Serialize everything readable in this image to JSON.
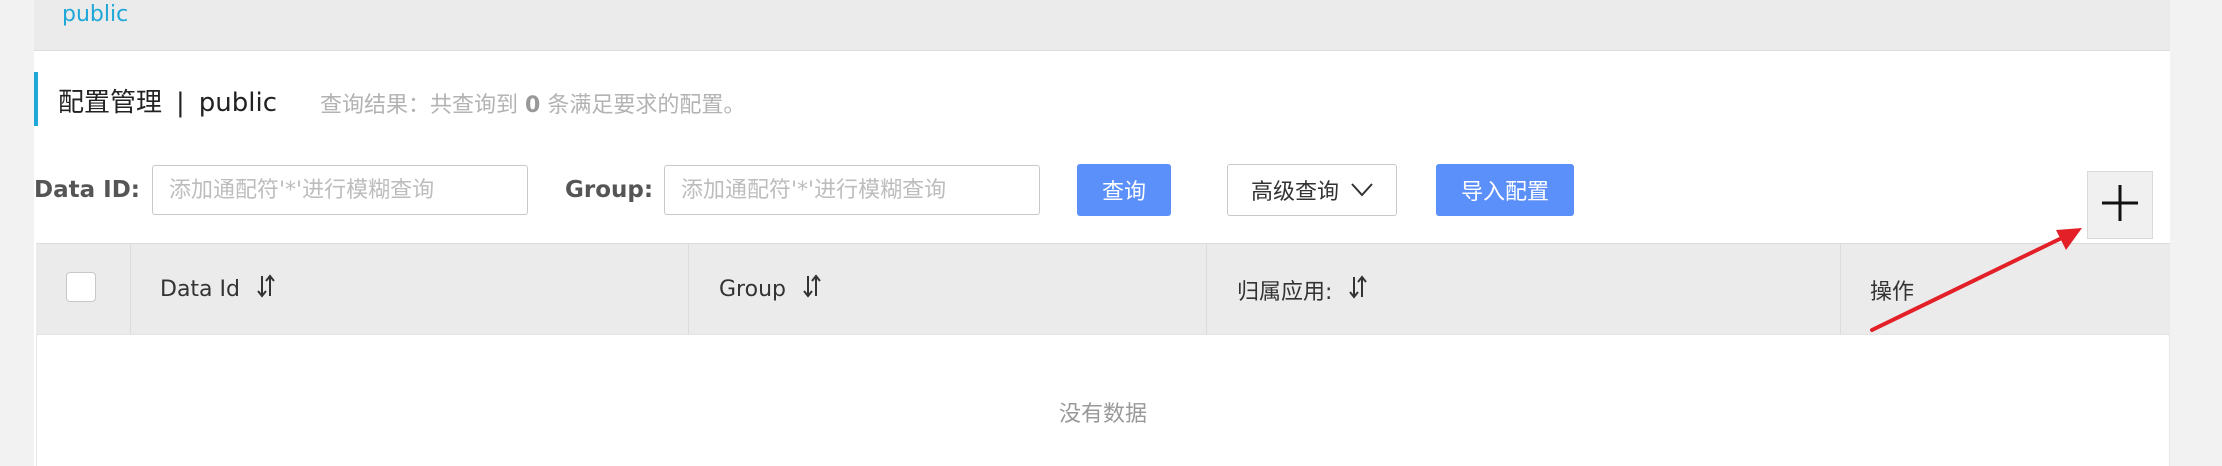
{
  "namespace_bar": {
    "active": "public"
  },
  "header": {
    "title": "配置管理",
    "separator": "|",
    "namespace": "public",
    "result_prefix": "查询结果：共查询到",
    "result_count": "0",
    "result_suffix": "条满足要求的配置。"
  },
  "search": {
    "data_id_label": "Data ID:",
    "data_id_placeholder": "添加通配符'*'进行模糊查询",
    "data_id_value": "",
    "group_label": "Group:",
    "group_placeholder": "添加通配符'*'进行模糊查询",
    "group_value": "",
    "query_button": "查询",
    "advanced_button": "高级查询",
    "import_button": "导入配置"
  },
  "table": {
    "columns": [
      {
        "label": "Data Id",
        "sortable": true
      },
      {
        "label": "Group",
        "sortable": true
      },
      {
        "label": "归属应用:",
        "sortable": true
      },
      {
        "label": "操作",
        "sortable": false
      }
    ],
    "rows": [],
    "empty_text": "没有数据"
  },
  "icons": {
    "add": "plus-icon",
    "sort": "sort-icon",
    "advanced": "chevron-down-icon"
  },
  "colors": {
    "accent": "#1fa7d8",
    "primary": "#5b8ff9",
    "annotation_arrow": "#e32028"
  }
}
